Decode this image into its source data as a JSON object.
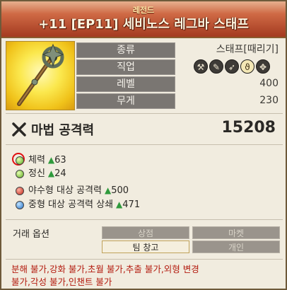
{
  "header": {
    "rarity": "레전드",
    "item_name": "+11 [EP11] 세비노스 레그바 스태프"
  },
  "stats": {
    "type_label": "종류",
    "type_value": "스태프[때리기]",
    "class_label": "직업",
    "class_icons": [
      "class-icon-1",
      "class-icon-2",
      "class-icon-3",
      "class-icon-4",
      "class-icon-5"
    ],
    "level_label": "레벨",
    "level_value": "400",
    "weight_label": "무게",
    "weight_value": "230"
  },
  "attack": {
    "label": "마법 공격력",
    "value": "15208"
  },
  "attributes": [
    {
      "name": "체력",
      "value": "63",
      "color": "green"
    },
    {
      "name": "정신",
      "value": "24",
      "color": "green"
    },
    {
      "name": "야수형 대상 공격력",
      "value": "500",
      "color": "red"
    },
    {
      "name": "중형 대상 공격력 상쇄",
      "value": "471",
      "color": "blue"
    }
  ],
  "trade": {
    "label": "거래 옵션",
    "shop": "상점",
    "market": "마켓",
    "team_storage": "팀 창고",
    "personal": "개인"
  },
  "restrictions": {
    "line1": "분해 불가,강화 불가,초월 불가,추출 불가,외형 변경",
    "line2": "불가,각성 불가,인챈트 불가"
  },
  "colors": {
    "header_top": "#e7b08f",
    "header_bottom": "#a43a20",
    "restriction_red": "#b31a0e",
    "positive_green": "#2f9a3c"
  }
}
